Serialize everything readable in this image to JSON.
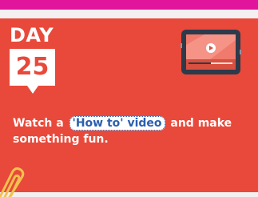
{
  "day_label": "DAY",
  "day_number": "25",
  "caption": {
    "before": "Watch a ",
    "link_text": "'How to' video",
    "after": " and make something fun."
  },
  "colors": {
    "card": "#e8493a",
    "top_bar": "#e0159b",
    "link": "#2a5fb0"
  },
  "icons": [
    "video-tablet-icon",
    "play-icon",
    "paperclip-icon"
  ]
}
